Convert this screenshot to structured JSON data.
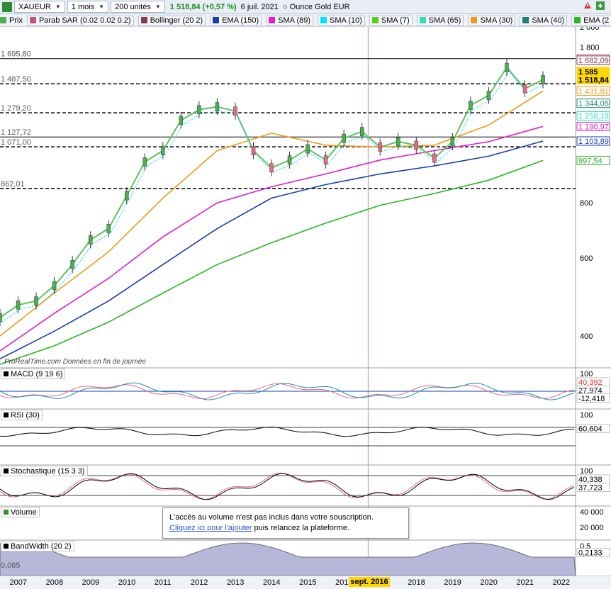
{
  "toolbar": {
    "symbol": "XAUEUR",
    "period": "1 mois",
    "units": "200 unités",
    "quote": "1 518,84 (+0,57 %)",
    "date": "6 juil. 2021",
    "instrument": "Ounce Gold EUR"
  },
  "legend": [
    {
      "label": "Prix",
      "color": "#4caf50"
    },
    {
      "label": "Parab SAR (0.02 0.02 0.2)",
      "color": "#c05a70"
    },
    {
      "label": "Bollinger (20 2)",
      "color": "#8a3b4d"
    },
    {
      "label": "EMA (150)",
      "color": "#1a3ea8"
    },
    {
      "label": "SMA (89)",
      "color": "#e020c8"
    },
    {
      "label": "SMA (10)",
      "color": "#00e5ff"
    },
    {
      "label": "SMA (7)",
      "color": "#55d01e"
    },
    {
      "label": "SMA (65)",
      "color": "#2de0b8"
    },
    {
      "label": "SMA (30)",
      "color": "#f09a1a"
    },
    {
      "label": "SMA (40)",
      "color": "#1f7f74"
    },
    {
      "label": "EMA (2",
      "color": "#2ab42a"
    }
  ],
  "watermark": "ProRealTime.com  Données en fin de journée",
  "panels": {
    "macd": "MACD (9 19 6)",
    "rsi": "RSI (30)",
    "stoch": "Stochastique (15 3 3)",
    "volume": "Volume",
    "bandwidth": "BandWidth (20 2)"
  },
  "notice": {
    "line1": "L'accès au volume n'est pas inclus dans votre souscription.",
    "link": "Cliquez ici pour l'ajouter",
    "line2": " puis relancez la plateforme."
  },
  "xaxis": {
    "ticks": [
      "2007",
      "2008",
      "2009",
      "2010",
      "2011",
      "2012",
      "2013",
      "2014",
      "2015",
      "201",
      "2018",
      "2019",
      "2020",
      "2021",
      "2022"
    ],
    "highlight": "sept. 2016"
  },
  "chart_data": [
    {
      "type": "line",
      "title": "XAUEUR",
      "scale": "log",
      "ylim": [
        340,
        2000
      ],
      "yticks": [
        {
          "value": 2000,
          "label": "2 000"
        },
        {
          "value": 1800,
          "label": "1 800"
        },
        {
          "value": 800,
          "label": "800"
        },
        {
          "value": 600,
          "label": "600"
        },
        {
          "value": 400,
          "label": "400"
        }
      ],
      "levels": [
        {
          "value": 1695.8,
          "label": "1 695,80",
          "style": "solid"
        },
        {
          "value": 1487.5,
          "label": "1 487,50",
          "style": "dashed"
        },
        {
          "value": 1279.2,
          "label": "1 279,20",
          "style": "dashed"
        },
        {
          "value": 1127.72,
          "label": "1 127,72",
          "style": "solid"
        },
        {
          "value": 1071.0,
          "label": "1 071,00",
          "style": "dashed"
        },
        {
          "value": 862.01,
          "label": "862,01",
          "style": "dashed"
        }
      ],
      "right_labels": [
        {
          "value": 1692.95,
          "label": "1 692,95",
          "color": "#c05a70"
        },
        {
          "value": 1682.09,
          "label": "1 682,09",
          "color": "#8a3b4d"
        },
        {
          "value": 1585,
          "label": "1 585",
          "color": "#ffd700"
        },
        {
          "value": 1518.84,
          "label": "1 518,84",
          "color": "#ffd700"
        },
        {
          "value": 1431.81,
          "label": "1 431,81",
          "color": "#f09a1a"
        },
        {
          "value": 1344.05,
          "label": "1 344,05",
          "color": "#1f7f74"
        },
        {
          "value": 1258.19,
          "label": "1 258,19",
          "color": "#2de0b8"
        },
        {
          "value": 1190.97,
          "label": "1 190,97",
          "color": "#e020c8"
        },
        {
          "value": 1103.89,
          "label": "1 103,89",
          "color": "#1a3ea8"
        },
        {
          "value": 997.54,
          "label": "997,54",
          "color": "#2ab42a"
        }
      ],
      "series": [
        {
          "name": "Prix",
          "x": [
            2006.5,
            2007,
            2007.5,
            2008,
            2008.5,
            2009,
            2009.5,
            2010,
            2010.5,
            2011,
            2011.5,
            2012,
            2012.5,
            2013,
            2013.5,
            2014,
            2014.5,
            2015,
            2015.5,
            2016,
            2016.5,
            2017,
            2017.5,
            2018,
            2018.5,
            2019,
            2019.5,
            2020,
            2020.5,
            2021,
            2021.5
          ],
          "values": [
            440,
            470,
            480,
            520,
            580,
            660,
            700,
            830,
            990,
            1050,
            1230,
            1300,
            1320,
            1290,
            1050,
            960,
            1000,
            1060,
            1000,
            1120,
            1160,
            1070,
            1100,
            1080,
            1010,
            1100,
            1330,
            1400,
            1620,
            1450,
            1519
          ]
        },
        {
          "name": "EMA (150)",
          "x": [
            2006.5,
            2008,
            2009.5,
            2011,
            2012.5,
            2014,
            2015.5,
            2017,
            2018.5,
            2020,
            2021.5
          ],
          "values": [
            355,
            410,
            480,
            580,
            700,
            820,
            880,
            930,
            970,
            1020,
            1104
          ]
        },
        {
          "name": "SMA (89)",
          "x": [
            2006.5,
            2008,
            2009.5,
            2011,
            2012.5,
            2014,
            2015.5,
            2017,
            2018.5,
            2020,
            2021.5
          ],
          "values": [
            370,
            450,
            540,
            670,
            800,
            870,
            930,
            1000,
            1050,
            1100,
            1191
          ]
        },
        {
          "name": "SMA (30)",
          "x": [
            2006.5,
            2008,
            2009.5,
            2011,
            2012.5,
            2014,
            2015.5,
            2017,
            2018.5,
            2020,
            2021.5
          ],
          "values": [
            400,
            500,
            620,
            820,
            1050,
            1150,
            1080,
            1070,
            1080,
            1200,
            1432
          ]
        },
        {
          "name": "EMA (2",
          "x": [
            2006.5,
            2008,
            2009.5,
            2011,
            2012.5,
            2014,
            2015.5,
            2017,
            2018.5,
            2020,
            2021.5
          ],
          "values": [
            345,
            380,
            430,
            500,
            580,
            650,
            720,
            790,
            840,
            900,
            998
          ]
        }
      ]
    },
    {
      "type": "line",
      "title": "MACD (9 19 6)",
      "right_labels": [
        {
          "value": 40.392,
          "label": "40,392"
        },
        {
          "value": 27.974,
          "label": "27,974"
        },
        {
          "value": -12.418,
          "label": "-12,418"
        }
      ],
      "yticks": [
        {
          "value": 100,
          "label": "100"
        }
      ]
    },
    {
      "type": "line",
      "title": "RSI (30)",
      "right_labels": [
        {
          "value": 60.604,
          "label": "60,604"
        }
      ],
      "yticks": [
        {
          "value": 100,
          "label": "100"
        }
      ]
    },
    {
      "type": "line",
      "title": "Stochastique (15 3 3)",
      "right_labels": [
        {
          "value": 40.338,
          "label": "40,338"
        },
        {
          "value": 37.723,
          "label": "37,723"
        }
      ],
      "yticks": [
        {
          "value": 100,
          "label": "100"
        }
      ]
    },
    {
      "type": "bar",
      "title": "Volume",
      "yticks": [
        {
          "value": 40000,
          "label": "40 000"
        },
        {
          "value": 20000,
          "label": "20 000"
        }
      ]
    },
    {
      "type": "area",
      "title": "BandWidth (20 2)",
      "right_labels": [
        {
          "value": 0.2133,
          "label": "0,2133"
        }
      ],
      "left_label": "0,085",
      "yticks": [
        {
          "value": 0.5,
          "label": "0,5"
        }
      ]
    }
  ]
}
